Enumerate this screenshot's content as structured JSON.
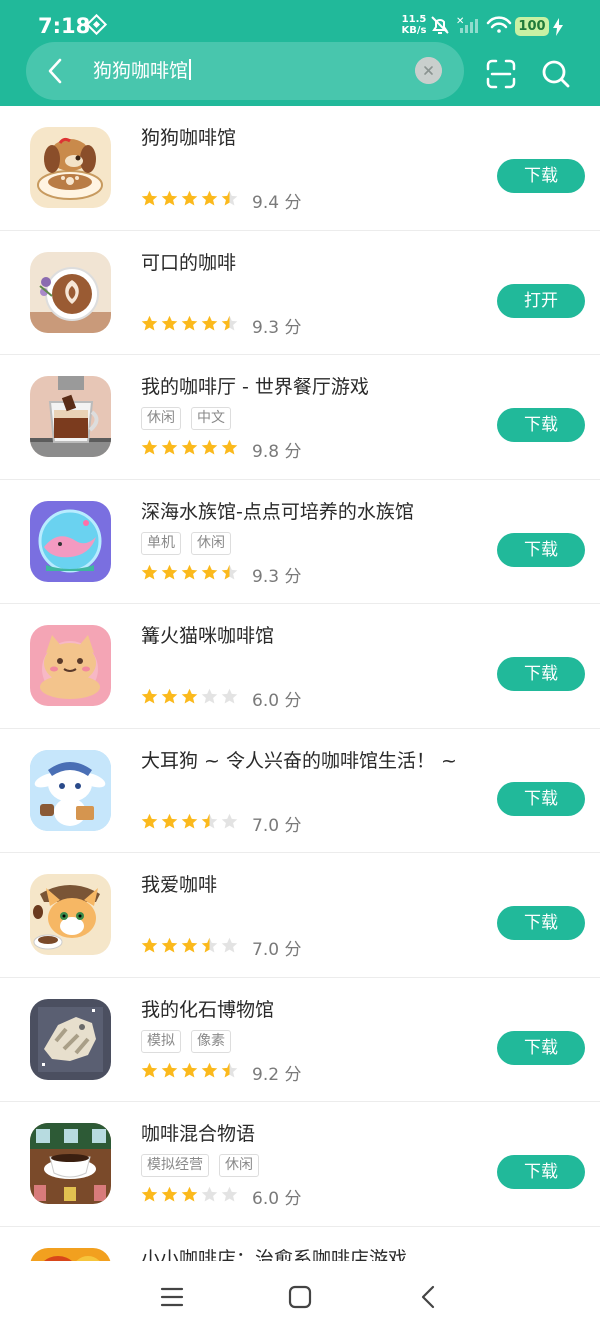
{
  "status_bar": {
    "time": "7:18",
    "net_speed_value": "11.5",
    "net_speed_unit": "KB/s",
    "battery": "100"
  },
  "search": {
    "query": "狗狗咖啡馆"
  },
  "apps": [
    {
      "name": "狗狗咖啡馆",
      "tags": [],
      "rating": 4.5,
      "score": "9.4 分",
      "action": "下载"
    },
    {
      "name": "可口的咖啡",
      "tags": [],
      "rating": 4.5,
      "score": "9.3 分",
      "action": "打开"
    },
    {
      "name": "我的咖啡厅 - 世界餐厅游戏",
      "tags": [
        "休闲",
        "中文"
      ],
      "rating": 5,
      "score": "9.8 分",
      "action": "下载"
    },
    {
      "name": "深海水族馆-点点可培养的水族馆",
      "tags": [
        "单机",
        "休闲"
      ],
      "rating": 4.5,
      "score": "9.3 分",
      "action": "下载"
    },
    {
      "name": "篝火猫咪咖啡馆",
      "tags": [],
      "rating": 3,
      "score": "6.0 分",
      "action": "下载"
    },
    {
      "name": "大耳狗 ~ 令人兴奋的咖啡馆生活！ ~",
      "tags": [],
      "rating": 3.5,
      "score": "7.0 分",
      "action": "下载"
    },
    {
      "name": "我爱咖啡",
      "tags": [],
      "rating": 3.5,
      "score": "7.0 分",
      "action": "下载"
    },
    {
      "name": "我的化石博物馆",
      "tags": [
        "模拟",
        "像素"
      ],
      "rating": 4.5,
      "score": "9.2 分",
      "action": "下载"
    },
    {
      "name": "咖啡混合物语",
      "tags": [
        "模拟经营",
        "休闲"
      ],
      "rating": 3,
      "score": "6.0 分",
      "action": "下载"
    },
    {
      "name": "小小咖啡店：治愈系咖啡店游戏",
      "tags": [],
      "rating": 0,
      "score": "",
      "action": ""
    }
  ],
  "colors": {
    "accent": "#21b99a",
    "star_on": "#fbb91c",
    "star_off": "#e3e3e3"
  }
}
